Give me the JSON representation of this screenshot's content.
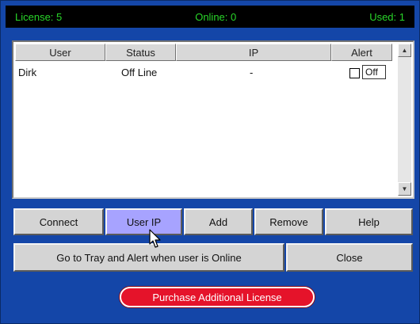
{
  "status": {
    "license": "License: 5",
    "online": "Online: 0",
    "used": "Used: 1"
  },
  "table": {
    "columns": [
      "User",
      "Status",
      "IP",
      "Alert"
    ],
    "rows": [
      {
        "user": "Dirk",
        "status": "Off Line",
        "ip": "-",
        "alert_checked": false,
        "alert": "Off"
      }
    ]
  },
  "buttons": {
    "connect": "Connect",
    "user_ip": "User IP",
    "add": "Add",
    "remove": "Remove",
    "help": "Help",
    "tray_alert": "Go to Tray and Alert when user is Online",
    "close": "Close",
    "purchase": "Purchase Additional License"
  },
  "colors": {
    "window_bg": "#1446a8",
    "status_text": "#29d629",
    "active_button": "#a7a3ff",
    "purchase_button": "#e5132a"
  },
  "icons": {
    "scroll_up": "scroll-up-arrow-icon",
    "scroll_down": "scroll-down-arrow-icon",
    "cursor": "mouse-cursor-icon"
  }
}
